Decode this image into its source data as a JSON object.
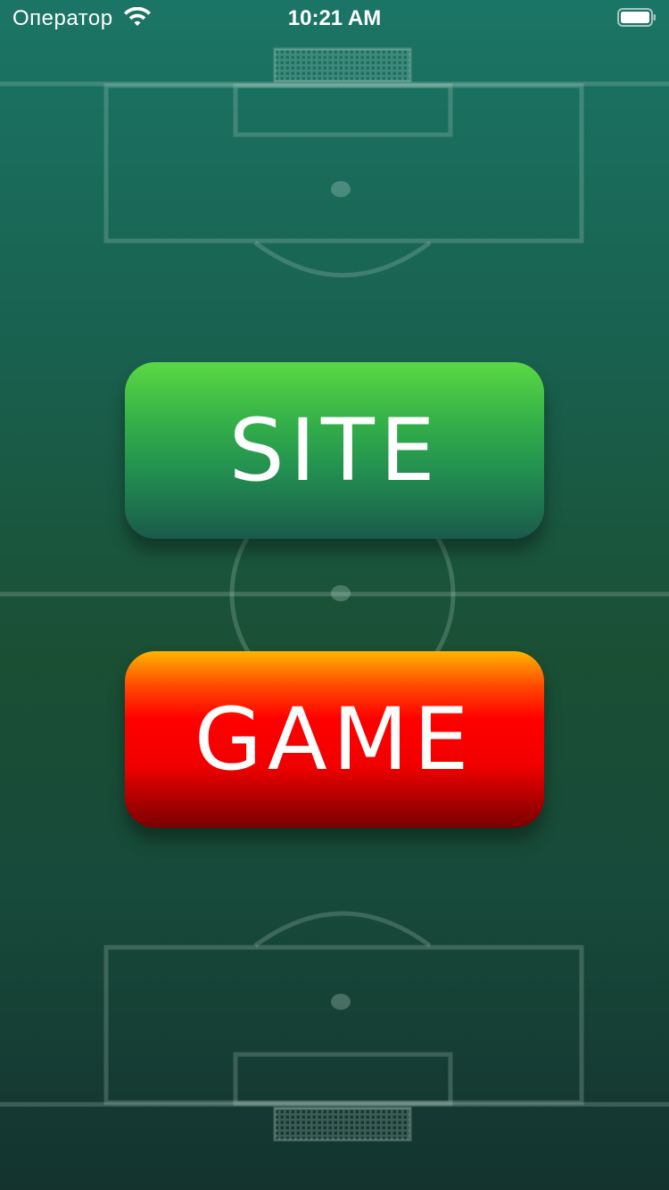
{
  "status_bar": {
    "carrier": "Оператор",
    "time": "10:21 AM",
    "wifi_icon": "wifi-icon",
    "battery_icon": "battery-icon"
  },
  "buttons": {
    "site_label": "SITE",
    "game_label": "GAME"
  },
  "colors": {
    "site_top": "#5cd844",
    "site_bottom": "#1a5a4c",
    "game_top": "#ffb400",
    "game_mid": "#ff0000",
    "game_bottom": "#7a0000",
    "label": "#ffffff"
  }
}
